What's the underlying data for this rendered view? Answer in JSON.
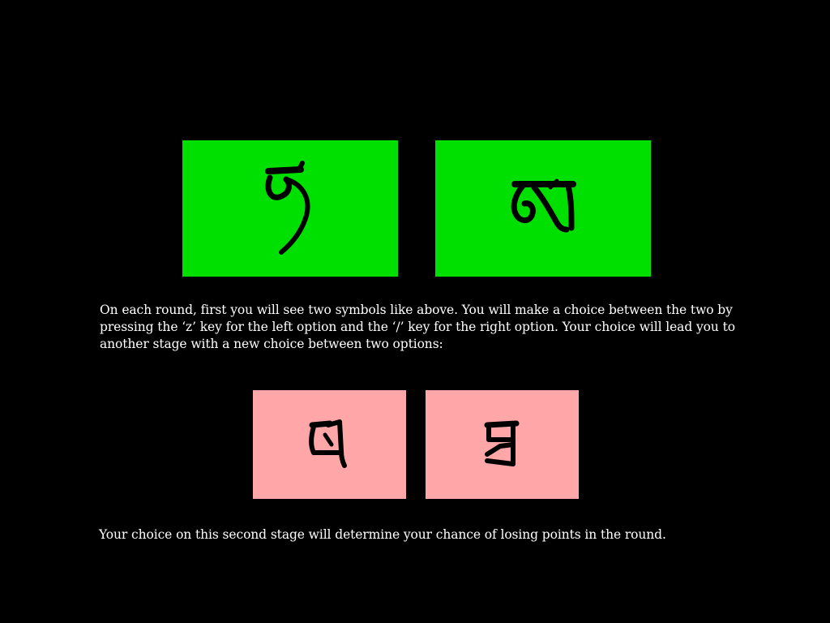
{
  "stage1": {
    "box_color": "#00e000",
    "left_symbol_icon": "tibetan-letter-nya-icon",
    "right_symbol_icon": "tibetan-letter-ma-icon"
  },
  "stage2": {
    "box_color": "#ffa6a8",
    "left_symbol_icon": "tibetan-letter-pa-icon",
    "right_symbol_icon": "tibetan-letter-ba-icon"
  },
  "text": {
    "instruction_1": "On each round, first you will see two symbols like above. You will make a choice between the two by pressing the ‘z’ key for the left option and the ‘/’ key for the right option. Your choice will lead you to another stage with a new choice between two options:",
    "instruction_2": "Your choice on this second stage will determine your chance of losing points in the round."
  },
  "colors": {
    "background": "#000000",
    "text": "#ffffff",
    "symbol": "#000000"
  }
}
